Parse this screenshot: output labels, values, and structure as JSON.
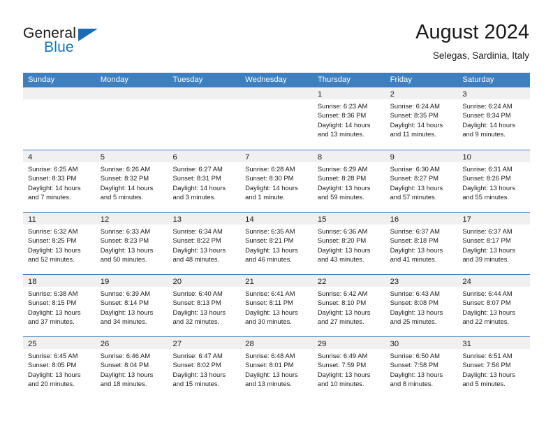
{
  "brand": {
    "word1": "General",
    "word2": "Blue",
    "triangle_color": "#1b6cb0",
    "blue_color": "#1077bd"
  },
  "header": {
    "title": "August 2024",
    "subtitle": "Selegas, Sardinia, Italy"
  },
  "theme": {
    "header_row_bg": "#3d7fbf",
    "date_bar_bg": "#f0f0f0",
    "cell_bg": "#ffffff",
    "text": "#1a1a1a"
  },
  "weekdays": [
    "Sunday",
    "Monday",
    "Tuesday",
    "Wednesday",
    "Thursday",
    "Friday",
    "Saturday"
  ],
  "weeks": [
    [
      {
        "day": "",
        "lines": []
      },
      {
        "day": "",
        "lines": []
      },
      {
        "day": "",
        "lines": []
      },
      {
        "day": "",
        "lines": []
      },
      {
        "day": "1",
        "lines": [
          "Sunrise: 6:23 AM",
          "Sunset: 8:36 PM",
          "Daylight: 14 hours",
          "and 13 minutes."
        ]
      },
      {
        "day": "2",
        "lines": [
          "Sunrise: 6:24 AM",
          "Sunset: 8:35 PM",
          "Daylight: 14 hours",
          "and 11 minutes."
        ]
      },
      {
        "day": "3",
        "lines": [
          "Sunrise: 6:24 AM",
          "Sunset: 8:34 PM",
          "Daylight: 14 hours",
          "and 9 minutes."
        ]
      }
    ],
    [
      {
        "day": "4",
        "lines": [
          "Sunrise: 6:25 AM",
          "Sunset: 8:33 PM",
          "Daylight: 14 hours",
          "and 7 minutes."
        ]
      },
      {
        "day": "5",
        "lines": [
          "Sunrise: 6:26 AM",
          "Sunset: 8:32 PM",
          "Daylight: 14 hours",
          "and 5 minutes."
        ]
      },
      {
        "day": "6",
        "lines": [
          "Sunrise: 6:27 AM",
          "Sunset: 8:31 PM",
          "Daylight: 14 hours",
          "and 3 minutes."
        ]
      },
      {
        "day": "7",
        "lines": [
          "Sunrise: 6:28 AM",
          "Sunset: 8:30 PM",
          "Daylight: 14 hours",
          "and 1 minute."
        ]
      },
      {
        "day": "8",
        "lines": [
          "Sunrise: 6:29 AM",
          "Sunset: 8:28 PM",
          "Daylight: 13 hours",
          "and 59 minutes."
        ]
      },
      {
        "day": "9",
        "lines": [
          "Sunrise: 6:30 AM",
          "Sunset: 8:27 PM",
          "Daylight: 13 hours",
          "and 57 minutes."
        ]
      },
      {
        "day": "10",
        "lines": [
          "Sunrise: 6:31 AM",
          "Sunset: 8:26 PM",
          "Daylight: 13 hours",
          "and 55 minutes."
        ]
      }
    ],
    [
      {
        "day": "11",
        "lines": [
          "Sunrise: 6:32 AM",
          "Sunset: 8:25 PM",
          "Daylight: 13 hours",
          "and 52 minutes."
        ]
      },
      {
        "day": "12",
        "lines": [
          "Sunrise: 6:33 AM",
          "Sunset: 8:23 PM",
          "Daylight: 13 hours",
          "and 50 minutes."
        ]
      },
      {
        "day": "13",
        "lines": [
          "Sunrise: 6:34 AM",
          "Sunset: 8:22 PM",
          "Daylight: 13 hours",
          "and 48 minutes."
        ]
      },
      {
        "day": "14",
        "lines": [
          "Sunrise: 6:35 AM",
          "Sunset: 8:21 PM",
          "Daylight: 13 hours",
          "and 46 minutes."
        ]
      },
      {
        "day": "15",
        "lines": [
          "Sunrise: 6:36 AM",
          "Sunset: 8:20 PM",
          "Daylight: 13 hours",
          "and 43 minutes."
        ]
      },
      {
        "day": "16",
        "lines": [
          "Sunrise: 6:37 AM",
          "Sunset: 8:18 PM",
          "Daylight: 13 hours",
          "and 41 minutes."
        ]
      },
      {
        "day": "17",
        "lines": [
          "Sunrise: 6:37 AM",
          "Sunset: 8:17 PM",
          "Daylight: 13 hours",
          "and 39 minutes."
        ]
      }
    ],
    [
      {
        "day": "18",
        "lines": [
          "Sunrise: 6:38 AM",
          "Sunset: 8:15 PM",
          "Daylight: 13 hours",
          "and 37 minutes."
        ]
      },
      {
        "day": "19",
        "lines": [
          "Sunrise: 6:39 AM",
          "Sunset: 8:14 PM",
          "Daylight: 13 hours",
          "and 34 minutes."
        ]
      },
      {
        "day": "20",
        "lines": [
          "Sunrise: 6:40 AM",
          "Sunset: 8:13 PM",
          "Daylight: 13 hours",
          "and 32 minutes."
        ]
      },
      {
        "day": "21",
        "lines": [
          "Sunrise: 6:41 AM",
          "Sunset: 8:11 PM",
          "Daylight: 13 hours",
          "and 30 minutes."
        ]
      },
      {
        "day": "22",
        "lines": [
          "Sunrise: 6:42 AM",
          "Sunset: 8:10 PM",
          "Daylight: 13 hours",
          "and 27 minutes."
        ]
      },
      {
        "day": "23",
        "lines": [
          "Sunrise: 6:43 AM",
          "Sunset: 8:08 PM",
          "Daylight: 13 hours",
          "and 25 minutes."
        ]
      },
      {
        "day": "24",
        "lines": [
          "Sunrise: 6:44 AM",
          "Sunset: 8:07 PM",
          "Daylight: 13 hours",
          "and 22 minutes."
        ]
      }
    ],
    [
      {
        "day": "25",
        "lines": [
          "Sunrise: 6:45 AM",
          "Sunset: 8:05 PM",
          "Daylight: 13 hours",
          "and 20 minutes."
        ]
      },
      {
        "day": "26",
        "lines": [
          "Sunrise: 6:46 AM",
          "Sunset: 8:04 PM",
          "Daylight: 13 hours",
          "and 18 minutes."
        ]
      },
      {
        "day": "27",
        "lines": [
          "Sunrise: 6:47 AM",
          "Sunset: 8:02 PM",
          "Daylight: 13 hours",
          "and 15 minutes."
        ]
      },
      {
        "day": "28",
        "lines": [
          "Sunrise: 6:48 AM",
          "Sunset: 8:01 PM",
          "Daylight: 13 hours",
          "and 13 minutes."
        ]
      },
      {
        "day": "29",
        "lines": [
          "Sunrise: 6:49 AM",
          "Sunset: 7:59 PM",
          "Daylight: 13 hours",
          "and 10 minutes."
        ]
      },
      {
        "day": "30",
        "lines": [
          "Sunrise: 6:50 AM",
          "Sunset: 7:58 PM",
          "Daylight: 13 hours",
          "and 8 minutes."
        ]
      },
      {
        "day": "31",
        "lines": [
          "Sunrise: 6:51 AM",
          "Sunset: 7:56 PM",
          "Daylight: 13 hours",
          "and 5 minutes."
        ]
      }
    ]
  ]
}
